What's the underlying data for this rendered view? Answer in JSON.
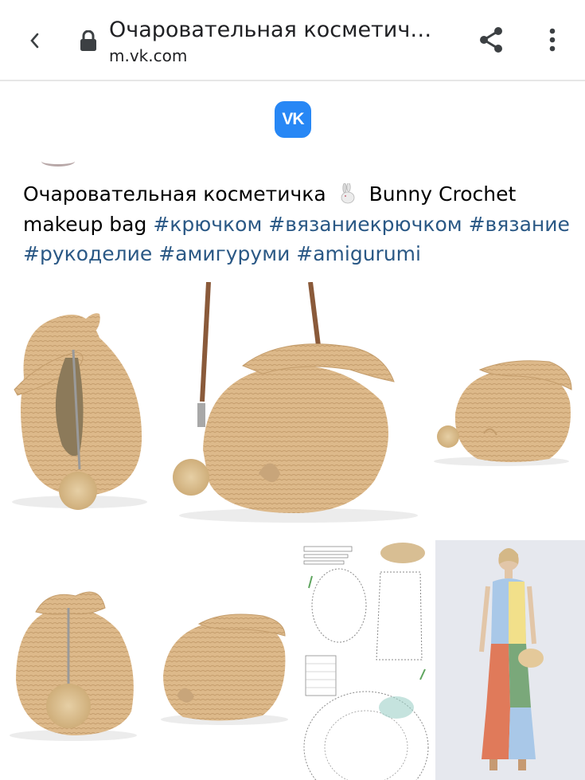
{
  "browser": {
    "title": "Очаровательная косметич…",
    "url": "m.vk.com",
    "icons": {
      "back": "chevron-left-icon",
      "lock": "lock-icon",
      "share": "share-icon",
      "menu": "more-vertical-icon"
    }
  },
  "vk": {
    "logo_text": "VK",
    "brand_color": "#2787f5"
  },
  "post": {
    "text_before_emoji": "Очаровательная косметичка",
    "emoji": "rabbit-emoji",
    "text_after_emoji": "Bunny Crochet makeup bag",
    "hashtags": [
      "#крючком",
      "#вязаниекрючком",
      "#вязание",
      "#рукоделие",
      "#амигуруми",
      "#amigurumi"
    ],
    "link_color": "#2a5885"
  },
  "photos": [
    {
      "subject": "crochet bunny bag, three views"
    },
    {
      "subject": "crochet bunny bag, front and side views"
    },
    {
      "subject": "crochet pattern chart"
    },
    {
      "subject": "model carrying bunny bag"
    }
  ]
}
